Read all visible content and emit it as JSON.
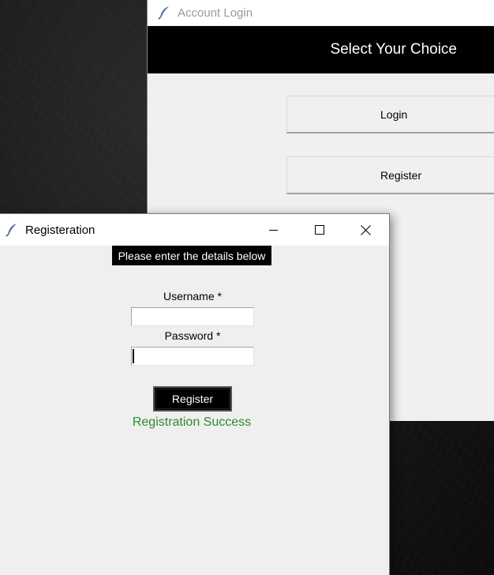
{
  "background_window": {
    "title": "Account Login",
    "header": "Select Your Choice",
    "buttons": {
      "login": "Login",
      "register": "Register"
    }
  },
  "registration_window": {
    "title": "Registeration",
    "controls": {
      "minimize": "minimize-icon",
      "maximize": "maximize-icon",
      "close": "close-icon"
    },
    "banner": "Please enter the details below",
    "username_label": "Username *",
    "username_value": "",
    "password_label": "Password *",
    "password_value": "",
    "register_button": "Register",
    "status_message": "Registration Success",
    "status_color": "#2e8b2e"
  },
  "icons": {
    "app": "feather-icon"
  }
}
